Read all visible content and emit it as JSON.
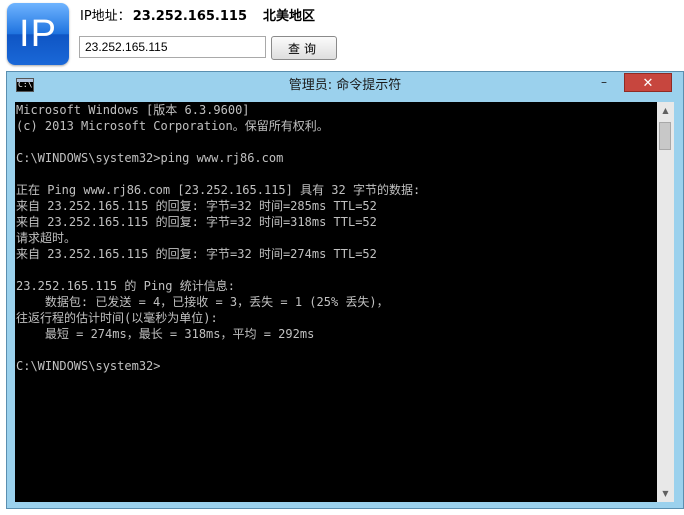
{
  "lookup": {
    "label": "IP地址：",
    "ip": "23.252.165.115",
    "region": "北美地区",
    "input_value": "23.252.165.115",
    "button_label": "查询",
    "logo_text": "IP"
  },
  "window": {
    "title": "管理员: 命令提示符",
    "icon_text": "C:\\",
    "controls": {
      "minimize": "–",
      "maximize": "□",
      "close": "✕"
    },
    "console_text": "Microsoft Windows [版本 6.3.9600]\n(c) 2013 Microsoft Corporation。保留所有权利。\n\nC:\\WINDOWS\\system32>ping www.rj86.com\n\n正在 Ping www.rj86.com [23.252.165.115] 具有 32 字节的数据:\n来自 23.252.165.115 的回复: 字节=32 时间=285ms TTL=52\n来自 23.252.165.115 的回复: 字节=32 时间=318ms TTL=52\n请求超时。\n来自 23.252.165.115 的回复: 字节=32 时间=274ms TTL=52\n\n23.252.165.115 的 Ping 统计信息:\n    数据包: 已发送 = 4，已接收 = 3，丢失 = 1 (25% 丢失)，\n往返行程的估计时间(以毫秒为单位):\n    最短 = 274ms，最长 = 318ms，平均 = 292ms\n\nC:\\WINDOWS\\system32>"
  },
  "icons": {
    "scroll_up": "▲",
    "scroll_down": "▼"
  }
}
